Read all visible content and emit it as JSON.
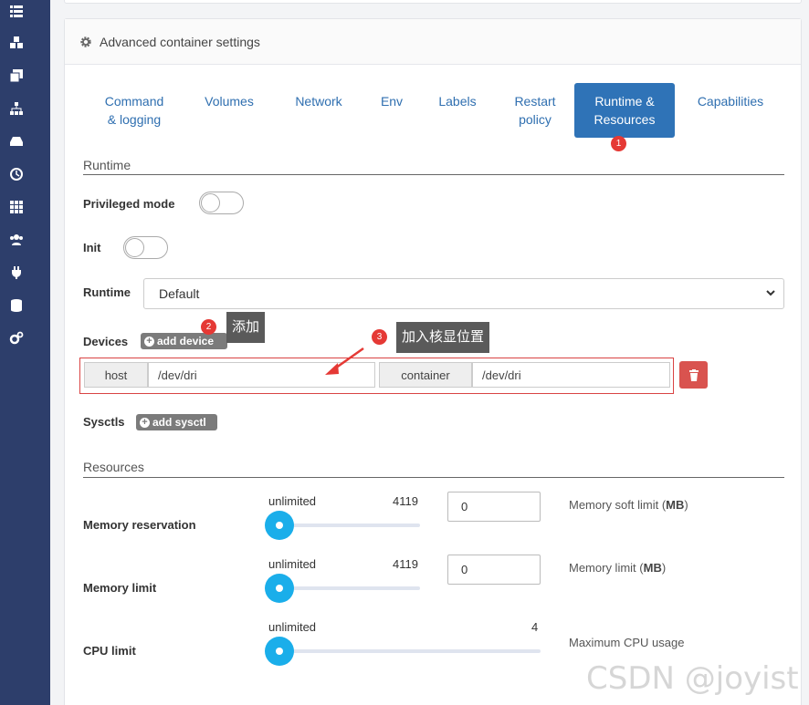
{
  "sidebar": {
    "icons": [
      "list-icon",
      "cubes-icon",
      "copy-icon",
      "sitemap-icon",
      "hdd-icon",
      "history-icon",
      "th-icon",
      "users-icon",
      "plug-icon",
      "database-icon",
      "cogs-icon"
    ]
  },
  "panel": {
    "title": "Advanced container settings"
  },
  "tabs": [
    {
      "label": "Command\n& logging"
    },
    {
      "label": "Volumes"
    },
    {
      "label": "Network"
    },
    {
      "label": "Env"
    },
    {
      "label": "Labels"
    },
    {
      "label": "Restart\npolicy"
    },
    {
      "label": "Runtime &\nResources",
      "active": true
    },
    {
      "label": "Capabilities"
    }
  ],
  "runtime": {
    "section_title": "Runtime",
    "privileged_label": "Privileged mode",
    "init_label": "Init",
    "runtime_label": "Runtime",
    "runtime_value": "Default",
    "devices_label": "Devices",
    "add_device": "add device",
    "device": {
      "host_label": "host",
      "host_value": "/dev/dri",
      "container_label": "container",
      "container_value": "/dev/dri"
    },
    "sysctls_label": "Sysctls",
    "add_sysctl": "add sysctl"
  },
  "resources": {
    "section_title": "Resources",
    "rows": [
      {
        "label": "Memory reservation",
        "min_text": "unlimited",
        "max_text": "4119",
        "input_value": "0",
        "hint_prefix": "Memory soft limit (",
        "hint_unit": "MB",
        "hint_suffix": ")",
        "slider_value": 0
      },
      {
        "label": "Memory limit",
        "min_text": "unlimited",
        "max_text": "4119",
        "input_value": "0",
        "hint_prefix": "Memory limit (",
        "hint_unit": "MB",
        "hint_suffix": ")",
        "slider_value": 0
      },
      {
        "label": "CPU limit",
        "min_text": "unlimited",
        "max_text": "4",
        "hint": "Maximum CPU usage",
        "slider_value": 0
      }
    ]
  },
  "annotations": [
    {
      "number": "1"
    },
    {
      "number": "2",
      "text": "添加"
    },
    {
      "number": "3",
      "text": "加入核显位置"
    }
  ],
  "watermark": "CSDN @joyist",
  "colors": {
    "sidebar": "#2d3e6b",
    "tab_active": "#2f73b7",
    "tab_text": "#2f6fb0",
    "slider_thumb": "#1aaeea",
    "delete": "#d9534f",
    "callout": "#e53935"
  }
}
